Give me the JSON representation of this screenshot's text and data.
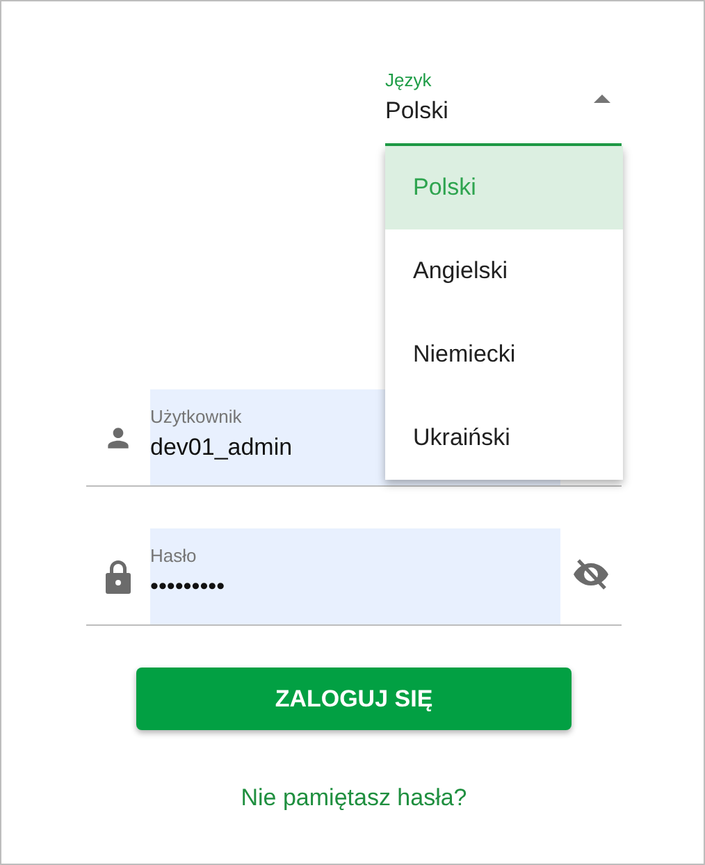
{
  "language": {
    "label": "Język",
    "value": "Polski",
    "expanded": true,
    "options": [
      {
        "label": "Polski",
        "selected": true
      },
      {
        "label": "Angielski",
        "selected": false
      },
      {
        "label": "Niemiecki",
        "selected": false
      },
      {
        "label": "Ukraiński",
        "selected": false
      }
    ]
  },
  "username": {
    "label": "Użytkownik",
    "value": "dev01_admin"
  },
  "password": {
    "label": "Hasło",
    "value": "•••••••••"
  },
  "login_button": "ZALOGUJ SIĘ",
  "forgot_link": "Nie pamiętasz hasła?"
}
